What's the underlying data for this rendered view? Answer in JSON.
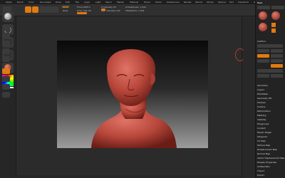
{
  "menubar": {
    "items": [
      "Alpha",
      "Brush",
      "Color",
      "Document",
      "Draw",
      "Edit",
      "File",
      "Layer",
      "Light",
      "Macro",
      "Marker",
      "Material",
      "Movie",
      "Picker",
      "Preferences",
      "Render",
      "Stencil",
      "Stroke",
      "Texture",
      "Tool",
      "Transform",
      "Zplugin",
      "Zscript"
    ]
  },
  "topshelf": {
    "zadd_label": "Zadd",
    "zsub_label": "Zsub",
    "focal_label": "Focal Shift 0",
    "draw_size_label": "Draw Size 64",
    "z_intensity_label": "Z Intensity 25",
    "rgb_intensity_label": "Rgb Intensity 100",
    "active_points_label": "ActivePoints: 1,544",
    "total_points_label": "TotalPoints: 1,544"
  },
  "tray": {
    "title": "Tool",
    "sections": [
      "SubTool",
      "Geometry",
      "Layers",
      "FiberMesh",
      "Geometry HD",
      "Preview",
      "Surface",
      "Deformation",
      "Masking",
      "Visibility",
      "Polygroups",
      "Contact",
      "Morph Target",
      "Polypaint",
      "UV Map",
      "Texture Map",
      "Displacement Map",
      "Normal Map",
      "Vector Displacement Map",
      "Display Properties",
      "Unified Skin",
      "Import",
      "Export"
    ]
  },
  "colors": {
    "accent": "#e07a12",
    "background": "#2b2b2b",
    "canvas_top": "#0a0a0a",
    "canvas_bottom": "#9c9c9c",
    "model": "#c9574a"
  },
  "icons": [
    "standard-brush-icon",
    "stroke-dots-icon",
    "alpha-icon",
    "texture-icon",
    "material-sphere-icon",
    "color-picker-icon"
  ]
}
